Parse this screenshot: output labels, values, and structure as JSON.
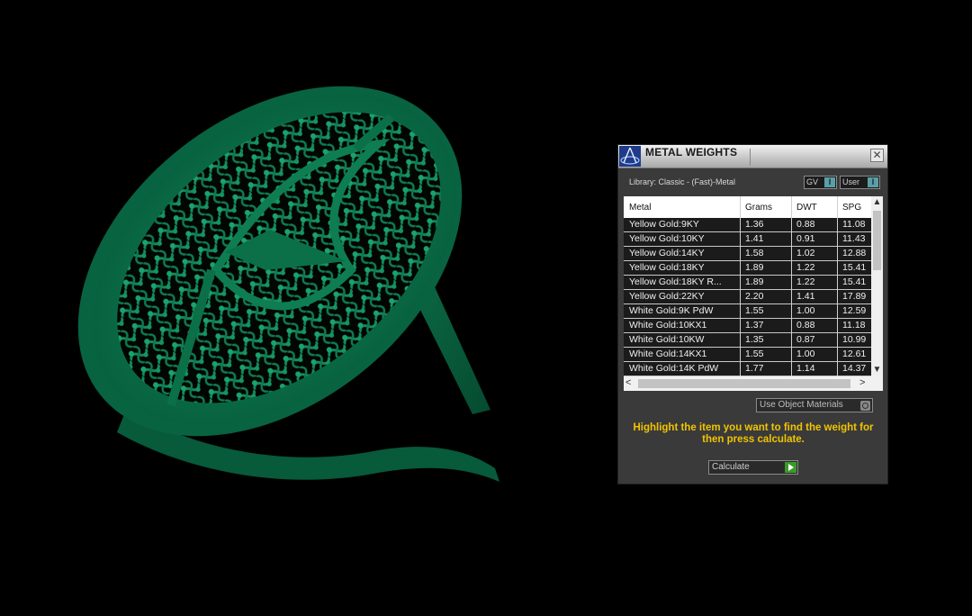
{
  "panel": {
    "title": "METAL WEIGHTS",
    "close_label": "✕",
    "library_label": "Library: Classic - (Fast)-Metal",
    "toggle_gv": "GV",
    "toggle_user": "User",
    "toggle_indicator": "I",
    "columns": [
      "Metal",
      "Grams",
      "DWT",
      "SPG"
    ],
    "rows": [
      [
        "Yellow Gold:9KY",
        "1.36",
        "0.88",
        "11.08"
      ],
      [
        "Yellow Gold:10KY",
        "1.41",
        "0.91",
        "11.43"
      ],
      [
        "Yellow Gold:14KY",
        "1.58",
        "1.02",
        "12.88"
      ],
      [
        "Yellow Gold:18KY",
        "1.89",
        "1.22",
        "15.41"
      ],
      [
        "Yellow Gold:18KY R...",
        "1.89",
        "1.22",
        "15.41"
      ],
      [
        "Yellow Gold:22KY",
        "2.20",
        "1.41",
        "17.89"
      ],
      [
        "White Gold:9K PdW",
        "1.55",
        "1.00",
        "12.59"
      ],
      [
        "White Gold:10KX1",
        "1.37",
        "0.88",
        "11.18"
      ],
      [
        "White Gold:10KW",
        "1.35",
        "0.87",
        "10.99"
      ],
      [
        "White Gold:14KX1",
        "1.55",
        "1.00",
        "12.61"
      ],
      [
        "White Gold:14K PdW",
        "1.77",
        "1.14",
        "14.37"
      ]
    ],
    "use_object_materials": "Use Object Materials",
    "instruction": "Highlight the item you want to find the weight for then press calculate.",
    "calculate_label": "Calculate",
    "accent_color": "#f1c400",
    "model_color": "#0d7a4e",
    "icons": [
      "app-logo-icon",
      "close-icon",
      "scroll-up-icon",
      "scroll-down-icon",
      "scroll-left-icon",
      "scroll-right-icon",
      "play-icon"
    ]
  }
}
